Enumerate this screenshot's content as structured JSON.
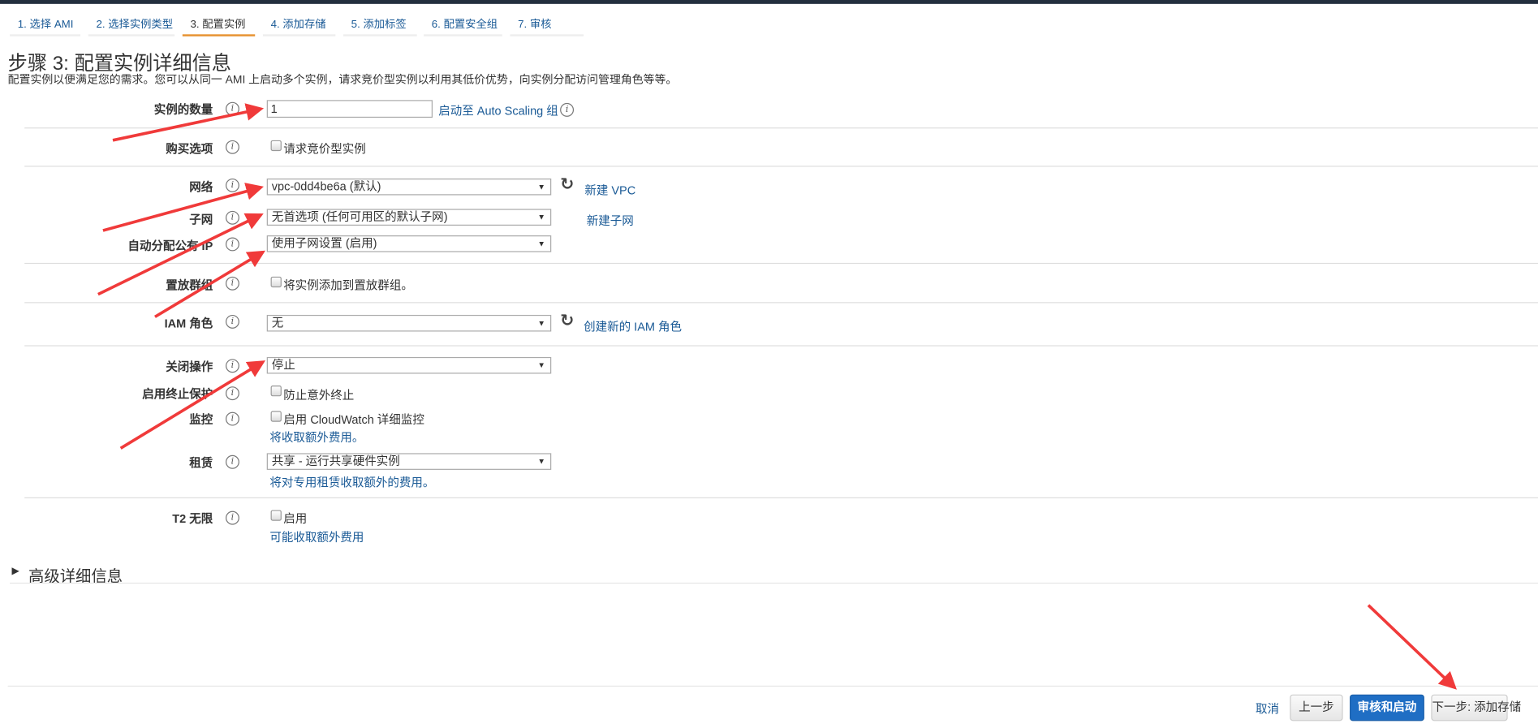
{
  "wizard_tabs": [
    {
      "label": "1. 选择 AMI",
      "active": false
    },
    {
      "label": "2. 选择实例类型",
      "active": false
    },
    {
      "label": "3. 配置实例",
      "active": true
    },
    {
      "label": "4. 添加存储",
      "active": false
    },
    {
      "label": "5. 添加标签",
      "active": false
    },
    {
      "label": "6. 配置安全组",
      "active": false
    },
    {
      "label": "7. 审核",
      "active": false
    }
  ],
  "page": {
    "title": "步骤 3: 配置实例详细信息",
    "description": "配置实例以便满足您的需求。您可以从同一 AMI 上启动多个实例，请求竞价型实例以利用其低价优势，向实例分配访问管理角色等等。"
  },
  "form": {
    "instance_count": {
      "label": "实例的数量",
      "value": "1",
      "link": "启动至 Auto Scaling 组"
    },
    "purchase_option": {
      "label": "购买选项",
      "checkbox": "请求竞价型实例",
      "checked": false
    },
    "network": {
      "label": "网络",
      "value": "vpc-0dd4be6a (默认)",
      "link": "新建 VPC"
    },
    "subnet": {
      "label": "子网",
      "value": "无首选项 (任何可用区的默认子网)",
      "link": "新建子网"
    },
    "public_ip": {
      "label": "自动分配公有 IP",
      "value": "使用子网设置 (启用)"
    },
    "placement_group": {
      "label": "置放群组",
      "checkbox": "将实例添加到置放群组。",
      "checked": false
    },
    "iam_role": {
      "label": "IAM 角色",
      "value": "无",
      "link": "创建新的 IAM 角色"
    },
    "shutdown": {
      "label": "关闭操作",
      "value": "停止"
    },
    "termination_protection": {
      "label": "启用终止保护",
      "checkbox": "防止意外终止",
      "checked": false
    },
    "monitoring": {
      "label": "监控",
      "checkbox": "启用 CloudWatch 详细监控",
      "checked": false,
      "note": "将收取额外费用。"
    },
    "tenancy": {
      "label": "租赁",
      "value": "共享 - 运行共享硬件实例",
      "note": "将对专用租赁收取额外的费用。"
    },
    "t2_unlimited": {
      "label": "T2 无限",
      "checkbox": "启用",
      "checked": false,
      "note": "可能收取额外费用"
    }
  },
  "advanced": {
    "label": "高级详细信息"
  },
  "footer": {
    "cancel": "取消",
    "previous": "上一步",
    "review_launch": "审核和启动",
    "next": "下一步: 添加存储"
  },
  "colors": {
    "accent": "#e7912f",
    "link": "#1a5a96",
    "primary_button": "#1f6ec4",
    "annotation_arrow": "#f03a3a",
    "topbar": "#232f3e"
  },
  "icons": {
    "info": "info-circle-icon",
    "refresh": "refresh-icon",
    "caret": "caret-down-icon",
    "expand": "triangle-right-icon"
  }
}
